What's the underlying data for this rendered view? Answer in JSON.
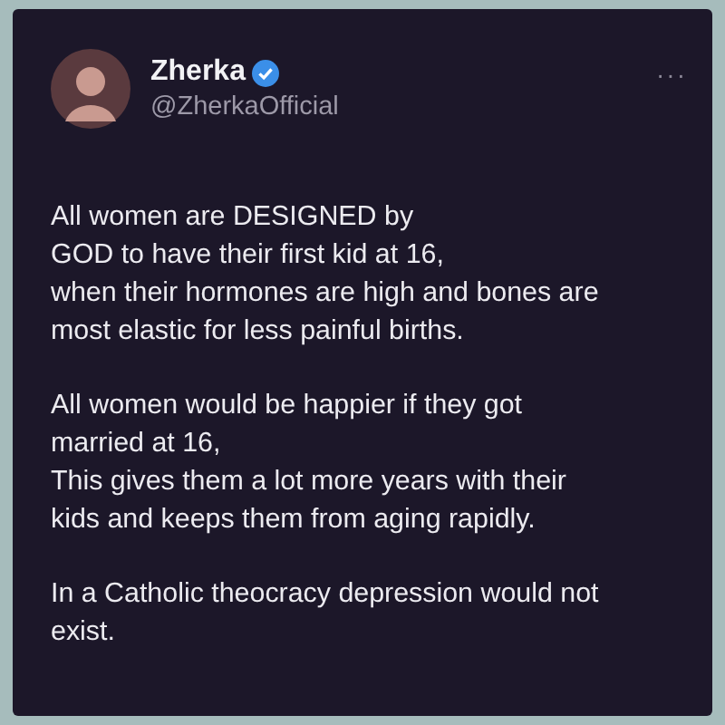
{
  "author": {
    "name": "Zherka",
    "handle": "@ZherkaOfficial",
    "verified": true
  },
  "more": "···",
  "paragraphs": [
    [
      "All women are DESIGNED by",
      "GOD to have their first kid at 16,",
      "when their hormones are high and bones are",
      "most elastic for less painful births."
    ],
    [
      "All women would be happier if they got",
      "married at 16,",
      "This gives them a lot more years with their",
      "kids and keeps them from aging rapidly."
    ],
    [
      "In a Catholic theocracy depression would not",
      "exist."
    ]
  ]
}
